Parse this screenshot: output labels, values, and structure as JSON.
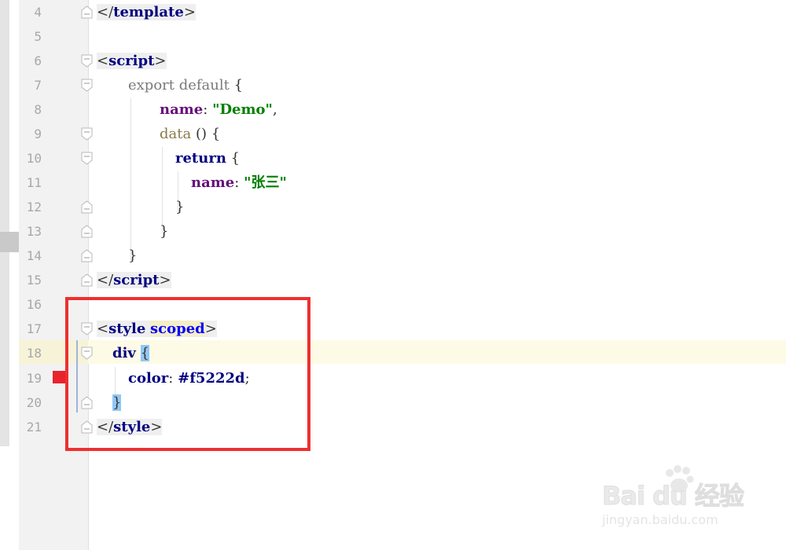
{
  "editor": {
    "lines": [
      {
        "num": "4"
      },
      {
        "num": "5"
      },
      {
        "num": "6"
      },
      {
        "num": "7"
      },
      {
        "num": "8"
      },
      {
        "num": "9"
      },
      {
        "num": "10"
      },
      {
        "num": "11"
      },
      {
        "num": "12"
      },
      {
        "num": "13"
      },
      {
        "num": "14"
      },
      {
        "num": "15"
      },
      {
        "num": "16"
      },
      {
        "num": "17"
      },
      {
        "num": "18"
      },
      {
        "num": "19"
      },
      {
        "num": "20"
      },
      {
        "num": "21"
      }
    ],
    "tokens": {
      "open_bracket": "<",
      "close_open": "</",
      "close_bracket": ">",
      "template": "template",
      "script": "script",
      "style": "style",
      "scoped": "scoped",
      "export_default": "export default",
      "open_brace": "{",
      "close_brace": "}",
      "name_key": "name",
      "colon": ":",
      "comma": ",",
      "demo_string": "\"Demo\"",
      "data_fn": "data",
      "parens": "()",
      "return_kw": "return",
      "zhang_string": "\"张三\"",
      "div_selector": "div",
      "color_prop": "color",
      "color_value": "#f5222d",
      "semicolon": ";"
    }
  },
  "watermark": {
    "main": "Bai du 经验",
    "sub": "jingyan.baidu.com"
  }
}
